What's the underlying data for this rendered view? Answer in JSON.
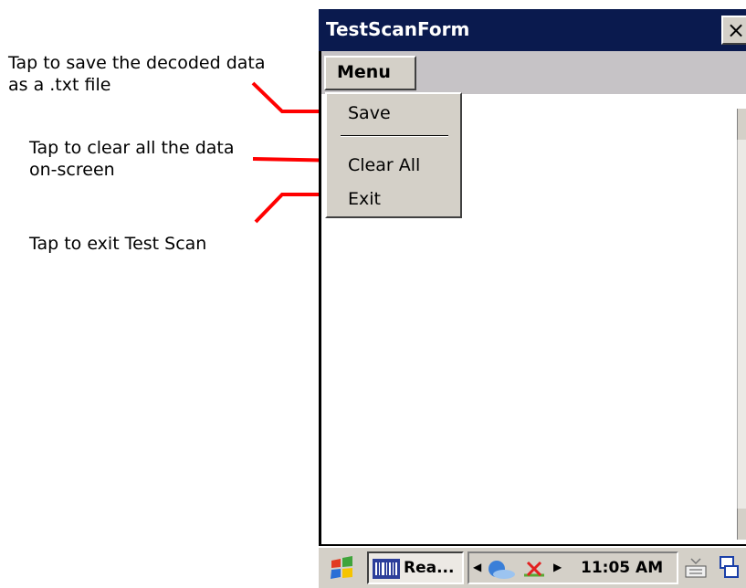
{
  "annotations": {
    "save": "Tap to save the decoded data as a .txt file",
    "clear": "Tap to clear all the data on-screen",
    "exit": "Tap to exit Test Scan"
  },
  "window": {
    "title": "TestScanForm",
    "close_label": "×"
  },
  "menubar": {
    "menu_label": "Menu"
  },
  "menu": {
    "items": [
      {
        "label": "Save"
      },
      {
        "label": "Clear All"
      },
      {
        "label": "Exit"
      }
    ]
  },
  "taskbar": {
    "task_label": "Rea...",
    "clock": "11:05 AM",
    "icons": [
      "windows-start-icon",
      "barcode-app-icon",
      "network-icon",
      "disconnected-icon",
      "keyboard-icon",
      "window-switch-icon"
    ]
  },
  "colors": {
    "titlebar": "#0a1a4e",
    "callout_line": "#ff0000",
    "chrome": "#d4d0c8"
  }
}
